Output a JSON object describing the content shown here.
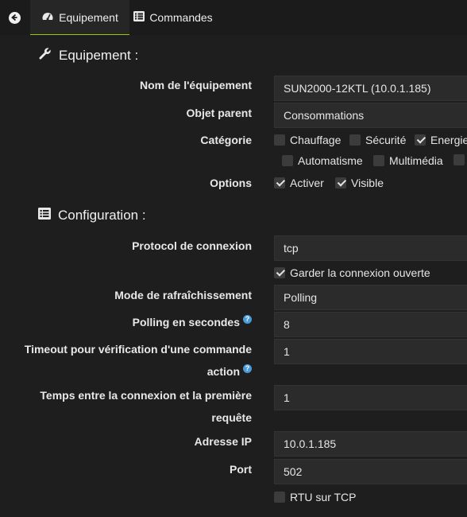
{
  "tabs": {
    "equipement": "Equipement",
    "commandes": "Commandes"
  },
  "sections": {
    "equipement_title": "Equipement :",
    "configuration_title": "Configuration :"
  },
  "labels": {
    "nom": "Nom de l'équipement",
    "objet": "Objet parent",
    "categorie": "Catégorie",
    "options": "Options",
    "protocol": "Protocol de connexion",
    "mode": "Mode de rafraîchissement",
    "polling": "Polling en secondes",
    "timeout_line1": "Timeout pour vérification d'une commande",
    "timeout_line2": "action",
    "temps_line1": "Temps entre la connexion et la première",
    "temps_line2": "requête",
    "ip": "Adresse IP",
    "port": "Port"
  },
  "values": {
    "nom": "SUN2000-12KTL (10.0.1.185)",
    "objet": "Consommations",
    "protocol": "tcp",
    "mode": "Polling",
    "polling": "8",
    "timeout": "1",
    "temps": "1",
    "ip": "10.0.1.185",
    "port": "502"
  },
  "categories": [
    {
      "label": "Chauffage",
      "checked": false
    },
    {
      "label": "Sécurité",
      "checked": false
    },
    {
      "label": "Energie",
      "checked": true
    },
    {
      "label": "Automatisme",
      "checked": false
    },
    {
      "label": "Multimédia",
      "checked": false
    }
  ],
  "options": [
    {
      "label": "Activer",
      "checked": true
    },
    {
      "label": "Visible",
      "checked": true
    }
  ],
  "checkboxes": {
    "garder": {
      "label": "Garder la connexion ouverte",
      "checked": true
    },
    "rtu": {
      "label": "RTU sur TCP",
      "checked": false
    }
  },
  "colors": {
    "accent": "#94ca02",
    "help": "#4b9bd9",
    "background": "#1e1e1e",
    "field": "#2b2b2b"
  },
  "icons": {
    "back": "arrow-left-circle-icon",
    "equipement": "tachometer-icon",
    "commandes": "list-icon",
    "section_equipement": "wrench-icon",
    "section_configuration": "list-icon",
    "help": "question-circle-icon"
  }
}
